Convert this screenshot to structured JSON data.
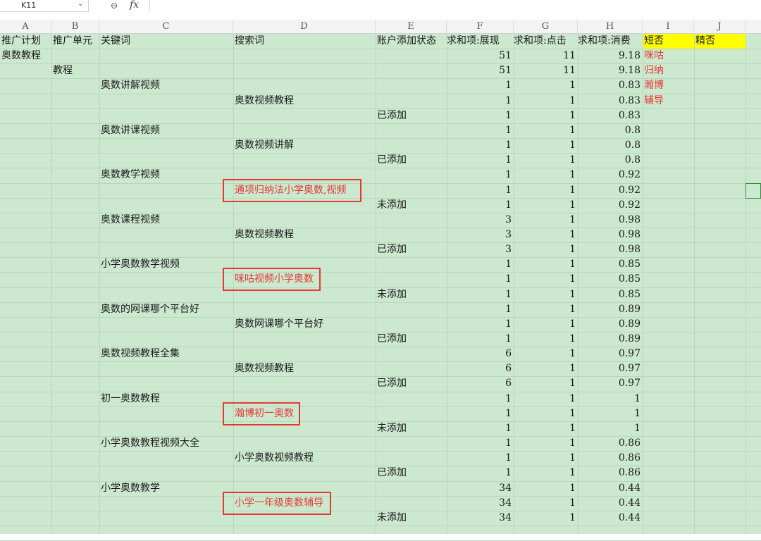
{
  "formula_bar": {
    "cell_ref": "K11",
    "dropdown_icon": "chevron-down-icon",
    "zoom_icon": "zoom-icon",
    "fx_label": "fx"
  },
  "columns": [
    "A",
    "B",
    "C",
    "D",
    "E",
    "F",
    "G",
    "H",
    "I",
    "J"
  ],
  "header": [
    "推广计划",
    "推广单元",
    "关键词",
    "搜索词",
    "账户添加状态",
    "求和项:展现",
    "求和项:点击",
    "求和项:消费",
    "短否",
    "精否"
  ],
  "colors": {
    "grid_bg": "#cce8cf",
    "highlight_yellow": "#ffff00",
    "alert_red": "#e53935"
  },
  "rows": [
    {
      "A": "奥数教程",
      "F": "51",
      "G": "11",
      "H": "9.18",
      "I": "咪咕"
    },
    {
      "B": "教程",
      "F": "51",
      "G": "11",
      "H": "9.18",
      "I": "归纳"
    },
    {
      "C": "奥数讲解视频",
      "F": "1",
      "G": "1",
      "H": "0.83",
      "I": "瀚博"
    },
    {
      "D": "奥数视频教程",
      "F": "1",
      "G": "1",
      "H": "0.83",
      "I": "辅导"
    },
    {
      "E": "已添加",
      "F": "1",
      "G": "1",
      "H": "0.83"
    },
    {
      "C": "奥数讲课视频",
      "F": "1",
      "G": "1",
      "H": "0.8"
    },
    {
      "D": "奥数视频讲解",
      "F": "1",
      "G": "1",
      "H": "0.8"
    },
    {
      "E": "已添加",
      "F": "1",
      "G": "1",
      "H": "0.8"
    },
    {
      "C": "奥数教学视频",
      "F": "1",
      "G": "1",
      "H": "0.92"
    },
    {
      "D": "通项归纳法小学奥数,视频",
      "F": "1",
      "G": "1",
      "H": "0.92",
      "highlight": true
    },
    {
      "E": "未添加",
      "F": "1",
      "G": "1",
      "H": "0.92"
    },
    {
      "C": "奥数课程视频",
      "F": "3",
      "G": "1",
      "H": "0.98"
    },
    {
      "D": "奥数视频教程",
      "F": "3",
      "G": "1",
      "H": "0.98"
    },
    {
      "E": "已添加",
      "F": "3",
      "G": "1",
      "H": "0.98"
    },
    {
      "C": "小学奥数教学视频",
      "F": "1",
      "G": "1",
      "H": "0.85"
    },
    {
      "D": "咪咕视频小学奥数",
      "F": "1",
      "G": "1",
      "H": "0.85",
      "highlight": true
    },
    {
      "E": "未添加",
      "F": "1",
      "G": "1",
      "H": "0.85"
    },
    {
      "C": "奥数的网课哪个平台好",
      "F": "1",
      "G": "1",
      "H": "0.89"
    },
    {
      "D": "奥数网课哪个平台好",
      "F": "1",
      "G": "1",
      "H": "0.89"
    },
    {
      "E": "已添加",
      "F": "1",
      "G": "1",
      "H": "0.89"
    },
    {
      "C": "奥数视频教程全集",
      "F": "6",
      "G": "1",
      "H": "0.97"
    },
    {
      "D": "奥数视频教程",
      "F": "6",
      "G": "1",
      "H": "0.97"
    },
    {
      "E": "已添加",
      "F": "6",
      "G": "1",
      "H": "0.97"
    },
    {
      "C": "初一奥数教程",
      "F": "1",
      "G": "1",
      "H": "1"
    },
    {
      "D": "瀚博初一奥数",
      "F": "1",
      "G": "1",
      "H": "1",
      "highlight": true
    },
    {
      "E": "未添加",
      "F": "1",
      "G": "1",
      "H": "1"
    },
    {
      "C": "小学奥数教程视频大全",
      "F": "1",
      "G": "1",
      "H": "0.86"
    },
    {
      "D": "小学奥数视频教程",
      "F": "1",
      "G": "1",
      "H": "0.86"
    },
    {
      "E": "已添加",
      "F": "1",
      "G": "1",
      "H": "0.86"
    },
    {
      "C": "小学奥数教学",
      "F": "34",
      "G": "1",
      "H": "0.44"
    },
    {
      "D": "小学一年级奥数辅导",
      "F": "34",
      "G": "1",
      "H": "0.44",
      "highlight": true
    },
    {
      "E": "未添加",
      "F": "34",
      "G": "1",
      "H": "0.44"
    }
  ]
}
